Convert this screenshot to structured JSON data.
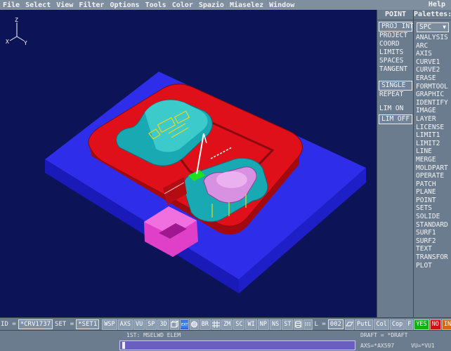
{
  "menu": {
    "items": [
      "File",
      "Select",
      "View",
      "Filter",
      "Options",
      "Tools",
      "Color",
      "Spazio",
      "Miaselez",
      "Window"
    ],
    "help": "Help"
  },
  "viewport": {
    "axis": {
      "z": "Z",
      "x": "X",
      "y": "Y"
    },
    "background": "#0d1357",
    "colors": {
      "base_top": "#2e2eea",
      "base_side": "#1a1ab8",
      "mold": "#e0101a",
      "mold_dark": "#a30a10",
      "part": "#19a9b2",
      "part_light": "#6ee0e0",
      "pink": "#e040c8",
      "core": "#d890e0"
    }
  },
  "point_panel": {
    "title": "POINT",
    "items": [
      {
        "label": "PROJ INT",
        "boxed": true
      },
      {
        "label": "PROJECT",
        "boxed": false
      },
      {
        "label": "COORD",
        "boxed": false
      },
      {
        "label": "LIMITS",
        "boxed": false
      },
      {
        "label": "SPACES",
        "boxed": false
      },
      {
        "label": "TANGENT",
        "boxed": false
      },
      {
        "label": "",
        "gap": true
      },
      {
        "label": "SINGLE",
        "boxed": true
      },
      {
        "label": "REPEAT",
        "boxed": false
      },
      {
        "label": "",
        "gap": true
      },
      {
        "label": "LIM ON",
        "boxed": false
      },
      {
        "label": "LIM OFF",
        "boxed": true
      }
    ]
  },
  "palettes_panel": {
    "title": "Palettes:",
    "selected": "SPC",
    "items": [
      "ANALYSIS",
      "ARC",
      "AXIS",
      "CURVE1",
      "CURVE2",
      "ERASE",
      "FORMTOOL",
      "GRAPHIC",
      "IDENTIFY",
      "IMAGE",
      "LAYER",
      "LICENSE",
      "LIMIT1",
      "LIMIT2",
      "LINE",
      "MERGE",
      "MOLDPART",
      "OPERATE",
      "PATCH",
      "PLANE",
      "POINT",
      "SETS",
      "SOLIDE",
      "STANDARD",
      "SURF1",
      "SURF2",
      "TEXT",
      "TRANSFOR",
      "PLOT"
    ]
  },
  "statusbar": {
    "id_label": "ID =",
    "id_value": "*CRV1737",
    "set_label": "SET =",
    "set_value": "*SET1",
    "buttons": [
      "WSP",
      "AXS",
      "VU",
      "SP",
      "3D"
    ],
    "buttons2": [
      "BR"
    ],
    "buttons3": [
      "ZM",
      "SC",
      "WI",
      "NP",
      "NS",
      "ST"
    ],
    "l_label": "L =",
    "l_value": "002",
    "buttons4": [
      "PutL",
      "Col",
      "Cop",
      "F"
    ],
    "yes": "YES",
    "no": "NO",
    "int": "INT",
    "yes_color": "#10b010",
    "no_color": "#d01010",
    "int_color": "#d06a10"
  },
  "messagebar": {
    "prompt": "1ST: MSELWD ELEM",
    "draft": "DRAFT = *DRAFT",
    "axs": "AXS=*AX597",
    "vu": "VU=*VU1"
  }
}
